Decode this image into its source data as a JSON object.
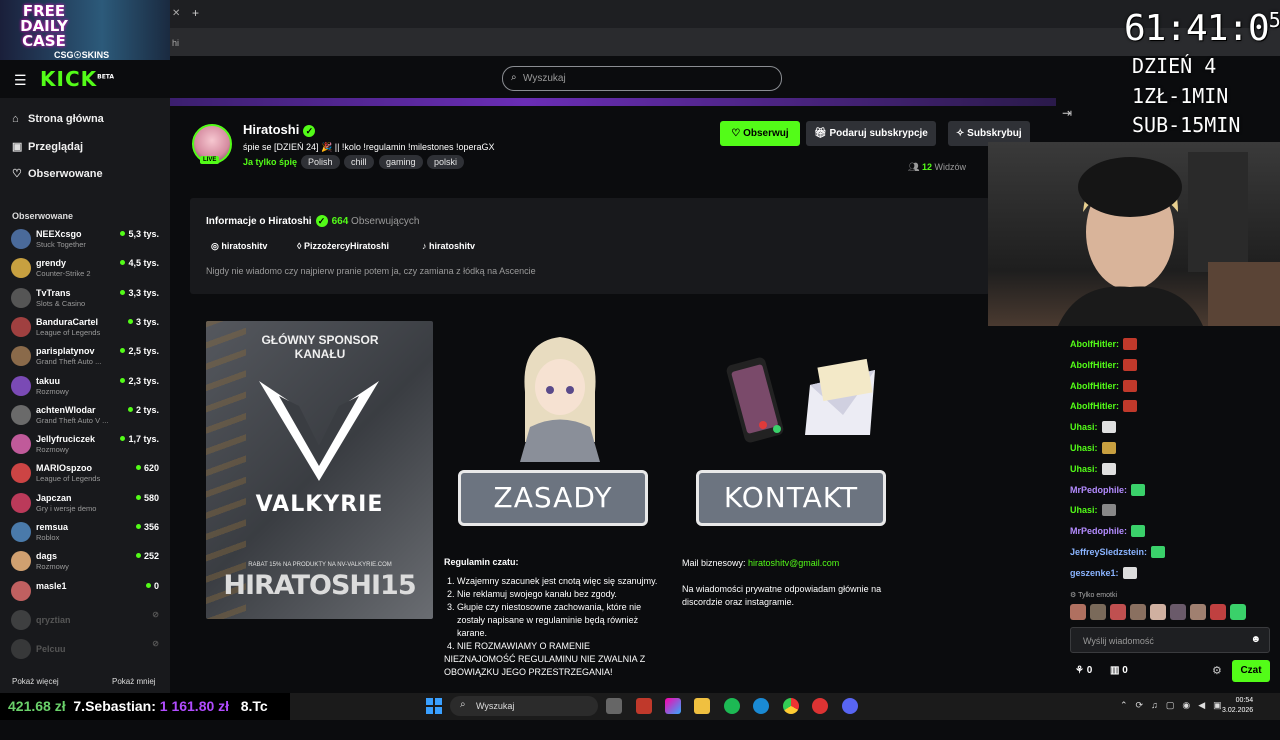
{
  "browser": {
    "address_fragment": "hi"
  },
  "promo": {
    "line1": "FREE",
    "line2": "DAILY",
    "line3": "CASE",
    "brand": "CSG☉SKINS"
  },
  "kick": {
    "logo": "KICK",
    "logo_sup": "BETA"
  },
  "search": {
    "placeholder": "Wyszukaj"
  },
  "sidebar": {
    "nav": [
      {
        "label": "Strona główna",
        "icon": "home-icon"
      },
      {
        "label": "Przeglądaj",
        "icon": "browse-icon"
      },
      {
        "label": "Obserwowane",
        "icon": "heart-icon"
      }
    ],
    "section_title": "Obserwowane",
    "channels": [
      {
        "name": "NEEXcsgo",
        "game": "Stuck Together",
        "viewers": "5,3 tys.",
        "live": true
      },
      {
        "name": "grendy",
        "game": "Counter-Strike 2",
        "viewers": "4,5 tys.",
        "live": true
      },
      {
        "name": "TvTrans",
        "game": "Slots & Casino",
        "viewers": "3,3 tys.",
        "live": true
      },
      {
        "name": "BanduraCartel",
        "game": "League of Legends",
        "viewers": "3 tys.",
        "live": true
      },
      {
        "name": "parisplatynov",
        "game": "Grand Theft Auto ...",
        "viewers": "2,5 tys.",
        "live": true
      },
      {
        "name": "takuu",
        "game": "Rozmowy",
        "viewers": "2,3 tys.",
        "live": true
      },
      {
        "name": "achtenWlodar",
        "game": "Grand Theft Auto V ...",
        "viewers": "2 tys.",
        "live": true
      },
      {
        "name": "Jellyfruciczek",
        "game": "Rozmowy",
        "viewers": "1,7 tys.",
        "live": true
      },
      {
        "name": "MARIOspzoo",
        "game": "League of Legends",
        "viewers": "620",
        "live": true
      },
      {
        "name": "Japczan",
        "game": "Gry i wersje demo",
        "viewers": "580",
        "live": true
      },
      {
        "name": "remsua",
        "game": "Roblox",
        "viewers": "356",
        "live": true
      },
      {
        "name": "dags",
        "game": "Rozmowy",
        "viewers": "252",
        "live": true
      },
      {
        "name": "masle1",
        "game": "",
        "viewers": "0",
        "live": true
      },
      {
        "name": "qryztian",
        "game": "",
        "viewers": "⊘",
        "live": false
      },
      {
        "name": "Pelcuu",
        "game": "",
        "viewers": "⊘",
        "live": false
      }
    ],
    "show_more": "Pokaż więcej",
    "show_less": "Pokaż mniej"
  },
  "stream": {
    "name": "Hiratoshi",
    "live_badge": "LIVE",
    "title": "śpie se [DZIEŃ 24] 🎉 || !kolo !regulamin !milestones !operaGX",
    "category": "Ja tylko śpię",
    "tags": [
      "Polish",
      "chill",
      "gaming",
      "polski"
    ],
    "follow_label": "Obserwuj",
    "gift_label": "Podaruj subskrypcje",
    "sub_label": "Subskrybuj",
    "viewers_count": "12",
    "viewers_label": "Widzów"
  },
  "about": {
    "title": "Informacje o Hiratoshi",
    "followers": "664",
    "followers_label": "Obserwujących",
    "socials": [
      {
        "icon": "instagram-icon",
        "label": "hiratoshitv"
      },
      {
        "icon": "pizza-icon",
        "label": "PizzożercyHiratoshi"
      },
      {
        "icon": "tiktok-icon",
        "label": "hiratoshitv"
      }
    ],
    "description": "Nigdy nie wiadomo czy najpierw pranie potem ja, czy zamiana z łódką na Ascencie"
  },
  "panels": {
    "sponsor_label": "GŁÓWNY SPONSOR KANAŁU",
    "sponsor_brand": "VALKYRIE",
    "sponsor_small": "RABAT 15% NA PRODUKTY NA NV-VALKYRIE.COM",
    "sponsor_code": "HIRATOSHI15",
    "rules_button": "ZASADY",
    "contact_button": "KONTAKT",
    "rules_title": "Regulamin czatu:",
    "rules": [
      "Wzajemny szacunek jest cnotą więc się szanujmy.",
      "Nie reklamuj swojego kanału bez zgody.",
      "Głupie czy niestosowne zachowania, które nie zostały napisane w regulaminie będą również karane.",
      "NIE ROZMAWIAMY O RAMENIE"
    ],
    "rules_extra": "NIEZNAJOMOŚĆ REGULAMINU NIE ZWALNIA Z OBOWIĄZKU JEGO PRZESTRZEGANIA!",
    "contact_label": "Mail biznesowy:",
    "contact_mail": "hiratoshitv@gmail.com",
    "contact_note": "Na wiadomości prywatne odpowiadam głównie na discordzie oraz instagramie."
  },
  "chat": {
    "messages": [
      {
        "user": "AbolfHitler:",
        "color": "#53fc18",
        "emote": "#c0392b"
      },
      {
        "user": "AbolfHitler:",
        "color": "#53fc18",
        "emote": "#c0392b"
      },
      {
        "user": "AbolfHitler:",
        "color": "#53fc18",
        "emote": "#c0392b"
      },
      {
        "user": "AbolfHitler:",
        "color": "#53fc18",
        "emote": "#c0392b"
      },
      {
        "user": "Uhasi:",
        "color": "#53fc18",
        "emote": "#e0e0e0"
      },
      {
        "user": "Uhasi:",
        "color": "#53fc18",
        "emote": "#c8a040"
      },
      {
        "user": "Uhasi:",
        "color": "#53fc18",
        "emote": "#e0e0e0"
      },
      {
        "user": "MrPedophile:",
        "color": "#b48cff",
        "emote": "#3ad16a"
      },
      {
        "user": "Uhasi:",
        "color": "#53fc18",
        "emote": "#888888"
      },
      {
        "user": "MrPedophile:",
        "color": "#b48cff",
        "emote": "#3ad16a"
      },
      {
        "user": "JeffreySledzstein:",
        "color": "#8ab4ff",
        "emote": "#3ad16a"
      },
      {
        "user": "geszenke1:",
        "color": "#8ab4ff",
        "emote": "#dddddd"
      }
    ],
    "emote_only_label": "Tylko emotki",
    "input_placeholder": "Wyślij wiadomość",
    "count1": "0",
    "count2": "0",
    "send_label": "Czat"
  },
  "overlay": {
    "timer": "61:41:0",
    "timer_sup": "5",
    "day": "DZIEŃ 4",
    "rate1": "1ZŁ-1MIN",
    "rate2": "SUB-15MIN"
  },
  "ticker": {
    "amount1": "421.68 zł",
    "name": "7.Sebastian:",
    "amount2": "1 161.80 zł",
    "next": "8.Tc"
  },
  "taskbar": {
    "search": "Wyszukaj",
    "time": "00:54",
    "date": "3.02.2026"
  }
}
